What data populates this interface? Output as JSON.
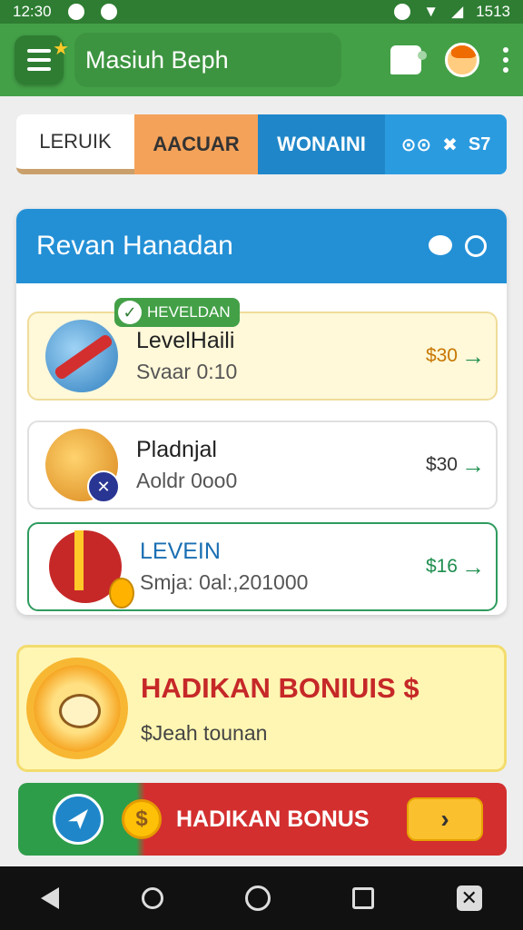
{
  "status_bar": {
    "time": "12:30",
    "battery": "1513"
  },
  "app_bar": {
    "title": "Masiuh Beph"
  },
  "tabs": [
    {
      "label": "LERUIK"
    },
    {
      "label": "AACUAR"
    },
    {
      "label": "WONAINI"
    },
    {
      "label": "S7"
    }
  ],
  "card": {
    "title": "Revan Hanadan",
    "badge": "HEVELDAN",
    "items": [
      {
        "title": "LevelHaili",
        "subtitle": "Svaar 0:10",
        "price": "$30"
      },
      {
        "title": "Pladnjal",
        "subtitle": "Aoldr 0oo0",
        "price": "$30"
      },
      {
        "title": "LEVEIN",
        "subtitle": "Smja: 0al:,201000",
        "price": "$16"
      }
    ]
  },
  "bonus_banner": {
    "title": "HADIKAN BONIUIS $",
    "subtitle": "$Jeah tounan"
  },
  "bonus_bar": {
    "title": "HADIKAN BONUS",
    "coin": "$",
    "button": "›"
  },
  "colors": {
    "primary_green": "#43a047",
    "header_blue": "#2390d6",
    "bonus_red": "#d32f2f",
    "bonus_yellow": "#fff6b3"
  }
}
